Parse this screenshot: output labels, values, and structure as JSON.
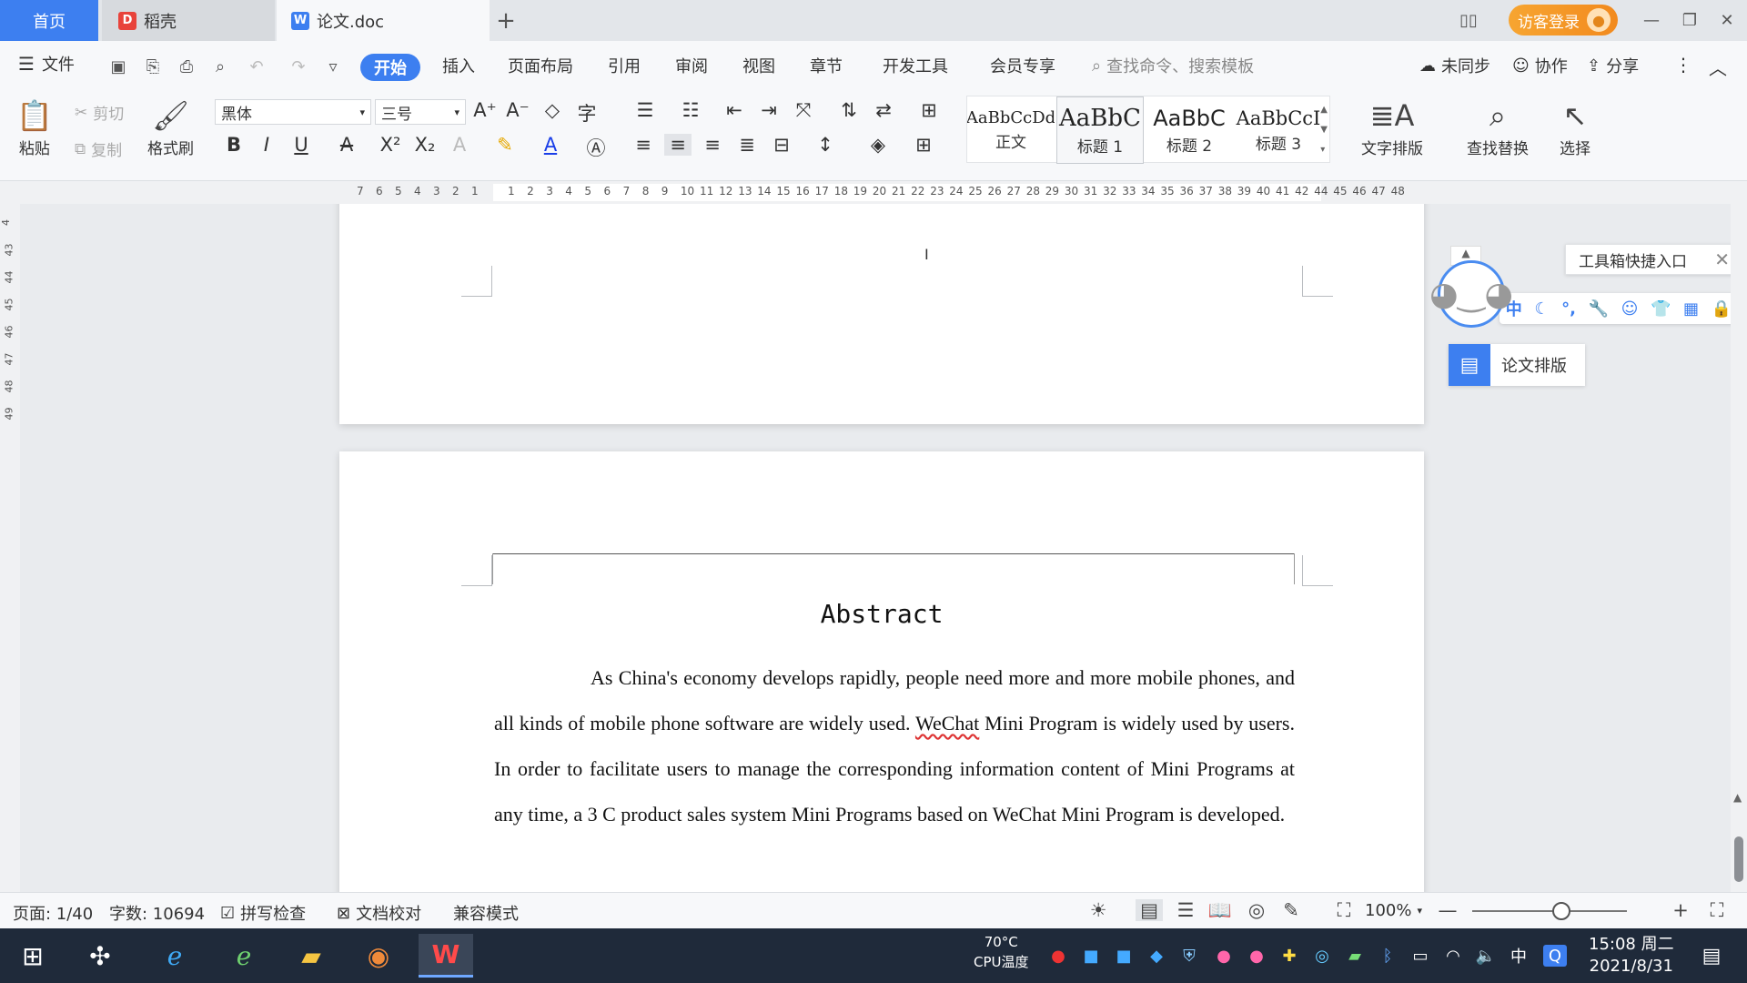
{
  "titlebar": {
    "tabs": [
      {
        "label": "首页"
      },
      {
        "label": "稻壳"
      },
      {
        "label": "论文.doc"
      }
    ],
    "window_mode_icon": "dual-window-icon",
    "login_label": "访客登录"
  },
  "menubar": {
    "file_label": "文件",
    "items": [
      "开始",
      "插入",
      "页面布局",
      "引用",
      "审阅",
      "视图",
      "章节",
      "开发工具",
      "会员专享"
    ],
    "search_placeholder": "查找命令、搜索模板",
    "sync_label": "未同步",
    "collab_label": "协作",
    "share_label": "分享"
  },
  "ribbon": {
    "paste_label": "粘贴",
    "cut_label": "剪切",
    "copy_label": "复制",
    "format_painter_label": "格式刷",
    "font_name": "黑体",
    "font_size": "三号",
    "styles": [
      {
        "sample": "AaBbCcDd",
        "name": "正文"
      },
      {
        "sample": "AaBbC",
        "name": "标题 1"
      },
      {
        "sample": "AaBbC",
        "name": "标题 2"
      },
      {
        "sample": "AaBbCcI",
        "name": "标题 3"
      }
    ],
    "text_layout_label": "文字排版",
    "find_replace_label": "查找替换",
    "select_label": "选择"
  },
  "ruler": {
    "left_ticks": [
      "7",
      "6",
      "5",
      "4",
      "3",
      "2",
      "1"
    ],
    "right_ticks": [
      "1",
      "2",
      "3",
      "4",
      "5",
      "6",
      "7",
      "8",
      "9",
      "10",
      "11",
      "12",
      "13",
      "14",
      "15",
      "16",
      "17",
      "18",
      "19",
      "20",
      "21",
      "22",
      "23",
      "24",
      "25",
      "26",
      "27",
      "28",
      "29",
      "30",
      "31",
      "32",
      "33",
      "34",
      "35",
      "36",
      "37",
      "38",
      "39",
      "40",
      "41",
      "42",
      "44",
      "45",
      "46",
      "47",
      "48"
    ],
    "vertical_ticks": [
      "4",
      "43",
      "44",
      "45",
      "46",
      "47",
      "48",
      "49"
    ]
  },
  "document": {
    "title": "Abstract",
    "body_before": "As China's economy develops rapidly, people need more and more mobile phones, and all kinds of mobile phone software are widely used. ",
    "body_misspelled": "WeChat",
    "body_after": " Mini Program is widely used by users. In order to facilitate users to manage the corresponding information content of Mini Programs at any time, a 3 C product sales system Mini Programs based on WeChat Mini Program is developed."
  },
  "side_tools": {
    "toolbox_label": "工具箱快捷入口",
    "ime_label": "中",
    "paper_format_label": "论文排版"
  },
  "statusbar": {
    "page_label": "页面: 1/40",
    "word_count_label": "字数: 10694",
    "spell_check_label": "拼写检查",
    "proofread_label": "文档校对",
    "compat_label": "兼容模式",
    "zoom_label": "100%"
  },
  "taskbar": {
    "cpu_temp": "70°C",
    "cpu_label": "CPU温度",
    "ime_label": "中",
    "time": "15:08 周二",
    "date": "2021/8/31"
  },
  "colors": {
    "accent": "#3d7ff0",
    "login": "#f28a1e",
    "taskbar": "#1f2a3a"
  }
}
